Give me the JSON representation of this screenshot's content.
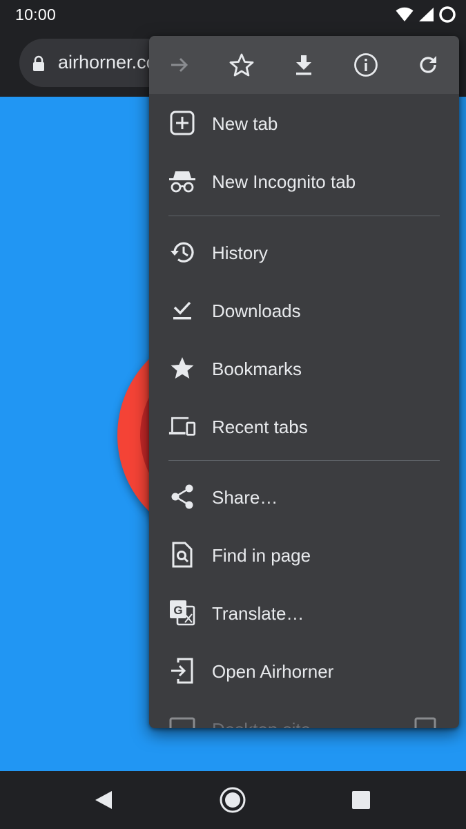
{
  "status_bar": {
    "time": "10:00",
    "icons": [
      "wifi-icon",
      "signal-icon",
      "circle-status-icon"
    ]
  },
  "toolbar": {
    "url": "airhorner.com",
    "lock_icon": "lock-icon"
  },
  "menu": {
    "icon_row": [
      "forward-icon",
      "star-outline-icon",
      "download-icon",
      "info-icon",
      "refresh-icon"
    ],
    "items": [
      {
        "label": "New tab",
        "icon": "new-tab-icon"
      },
      {
        "label": "New Incognito tab",
        "icon": "incognito-icon"
      },
      {
        "label": "History",
        "icon": "history-icon"
      },
      {
        "label": "Downloads",
        "icon": "downloads-icon"
      },
      {
        "label": "Bookmarks",
        "icon": "bookmarks-star-icon"
      },
      {
        "label": "Recent tabs",
        "icon": "devices-icon"
      },
      {
        "label": "Share…",
        "icon": "share-icon"
      },
      {
        "label": "Find in page",
        "icon": "find-in-page-icon"
      },
      {
        "label": "Translate…",
        "icon": "translate-icon"
      },
      {
        "label": "Open Airhorner",
        "icon": "open-app-icon"
      },
      {
        "label": "Desktop site",
        "icon": "desktop-icon"
      }
    ]
  },
  "navbar": {
    "buttons": [
      "back-icon",
      "home-icon",
      "recents-icon"
    ]
  },
  "colors": {
    "page_bg": "#2196f3",
    "horn_red": "#f44336",
    "menu_bg": "#3c3d40",
    "text": "#e8eaed"
  }
}
